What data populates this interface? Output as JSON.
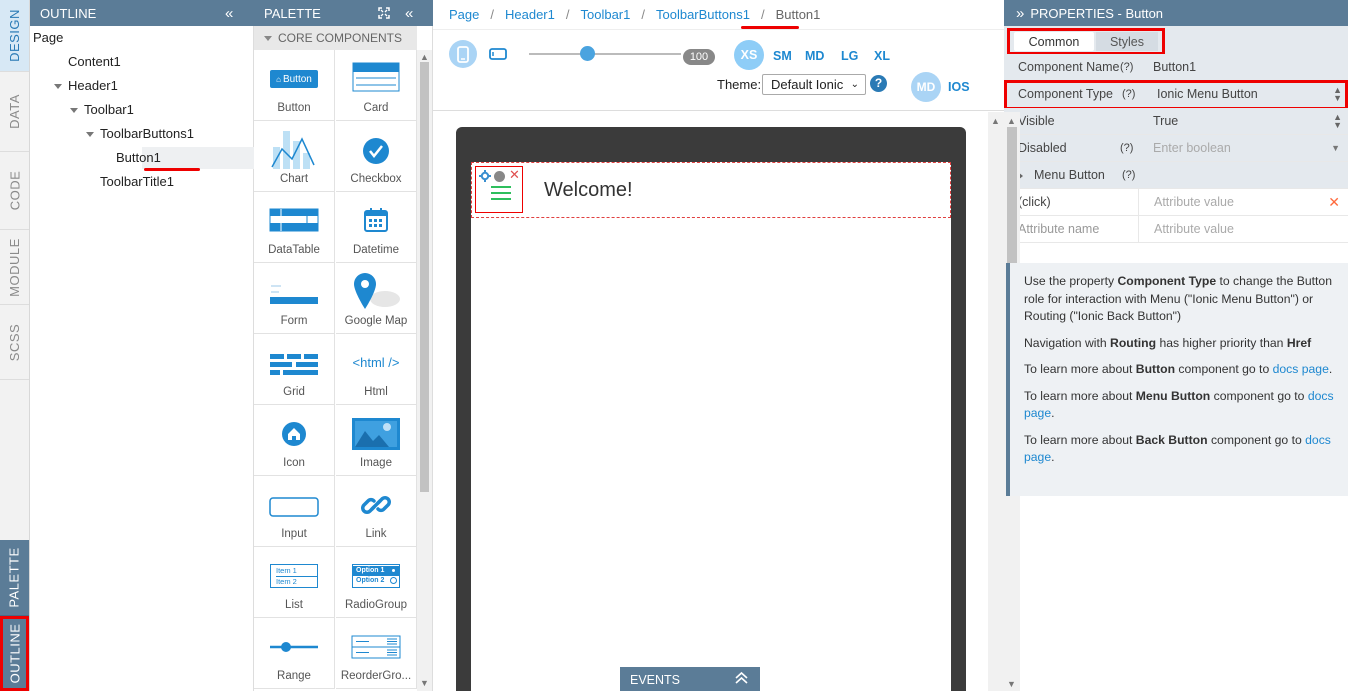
{
  "vtabs": {
    "design": "DESIGN",
    "data": "DATA",
    "code": "CODE",
    "module": "MODULE",
    "scss": "SCSS",
    "palette": "PALETTE",
    "outline": "OUTLINE"
  },
  "outline": {
    "title": "OUTLINE",
    "collapse": "«",
    "items": [
      "Page",
      "Content1",
      "Header1",
      "Toolbar1",
      "ToolbarButtons1",
      "Button1",
      "ToolbarTitle1"
    ]
  },
  "palette": {
    "title": "PALETTE",
    "collapse": "«",
    "section": "CORE COMPONENTS",
    "items": [
      "Button",
      "Card",
      "Chart",
      "Checkbox",
      "DataTable",
      "Datetime",
      "Form",
      "Google Map",
      "Grid",
      "Html",
      "Icon",
      "Image",
      "Input",
      "Link",
      "List",
      "RadioGroup",
      "Range",
      "ReorderGro..."
    ],
    "button_icon_text": "Button",
    "html_icon_text": "<html />",
    "list_icon_items": [
      "Item 1",
      "Item 2"
    ],
    "radio_icon_items": [
      "Option 1",
      "Option 2"
    ]
  },
  "breadcrumb": [
    "Page",
    "Header1",
    "Toolbar1",
    "ToolbarButtons1",
    "Button1"
  ],
  "toolbar": {
    "zoom": "100",
    "sizes": [
      "XS",
      "SM",
      "MD",
      "LG",
      "XL"
    ],
    "active_size": "XS",
    "theme_label": "Theme:",
    "theme_value": "Default Ionic",
    "help": "?",
    "modes": [
      "MD",
      "IOS"
    ]
  },
  "canvas": {
    "header_title": "Welcome!",
    "events_label": "EVENTS"
  },
  "properties": {
    "title": "PROPERTIES - Button",
    "expand": "»",
    "tabs": [
      "Common",
      "Styles"
    ],
    "rows": {
      "component_name": {
        "key": "Component Name",
        "q": "(?)",
        "value": "Button1"
      },
      "component_type": {
        "key": "Component Type",
        "q": "(?)",
        "value": "Ionic Menu Button"
      },
      "visible": {
        "key": "Visible",
        "value": "True"
      },
      "disabled": {
        "key": "Disabled",
        "q": "(?)",
        "value": "Enter boolean"
      },
      "menu_button": {
        "key": "Menu Button",
        "q": "(?)"
      },
      "click": {
        "key": "(click)",
        "value": "Attribute value"
      },
      "attr": {
        "key": "Attribute name",
        "value": "Attribute value"
      }
    },
    "info": {
      "p1a": "Use the property ",
      "p1b": "Component Type",
      "p1c": " to change the Button role for interaction with Menu (\"Ionic Menu Button\") or Routing (\"Ionic Back Button\")",
      "p2a": "Navigation with ",
      "p2b": "Routing",
      "p2c": " has higher priority than ",
      "p2d": "Href",
      "p3a": "To learn more about ",
      "p3b": "Button",
      "p3c": " component go to ",
      "p3link": "docs page",
      "p4b": "Menu Button",
      "p5b": "Back Button",
      "dot": "."
    }
  }
}
